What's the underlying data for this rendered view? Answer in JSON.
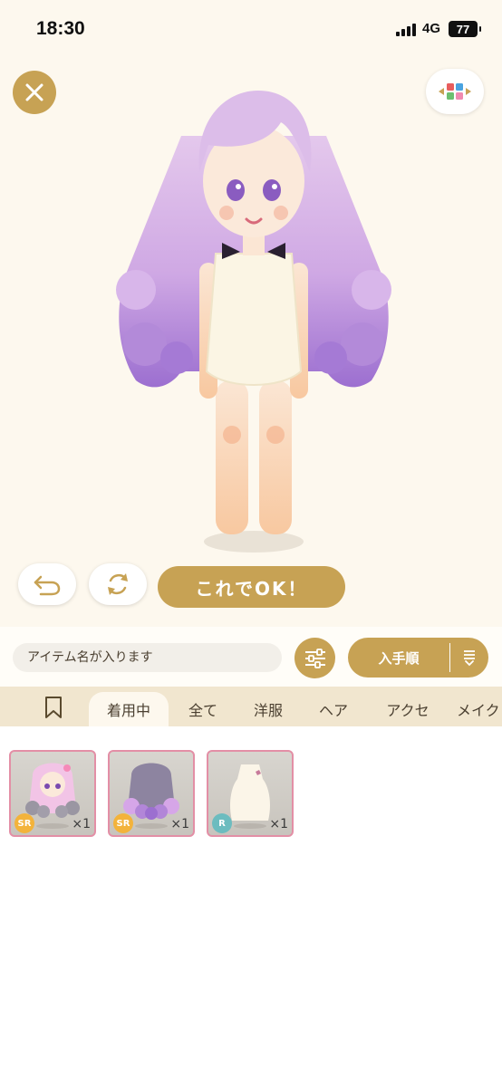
{
  "status_bar": {
    "time": "18:30",
    "network": "4G",
    "battery": "77"
  },
  "preview": {
    "ok_label": "これでOK！"
  },
  "search": {
    "placeholder": "アイテム名が入ります"
  },
  "sort": {
    "label": "入手順"
  },
  "tabs": [
    {
      "label": "着用中",
      "active": true
    },
    {
      "label": "全て"
    },
    {
      "label": "洋服"
    },
    {
      "label": "ヘア"
    },
    {
      "label": "アクセ"
    },
    {
      "label": "メイク"
    }
  ],
  "items": [
    {
      "rarity": "SR",
      "quantity": "×1",
      "icon": "hair-pink-icon"
    },
    {
      "rarity": "SR",
      "quantity": "×1",
      "icon": "hair-purple-icon"
    },
    {
      "rarity": "R",
      "quantity": "×1",
      "icon": "dress-white-icon"
    }
  ],
  "colors": {
    "accent": "#c7a254",
    "background": "#fdf8ee",
    "tab_bar": "#f1e6cf",
    "item_border": "#e38fa6"
  }
}
